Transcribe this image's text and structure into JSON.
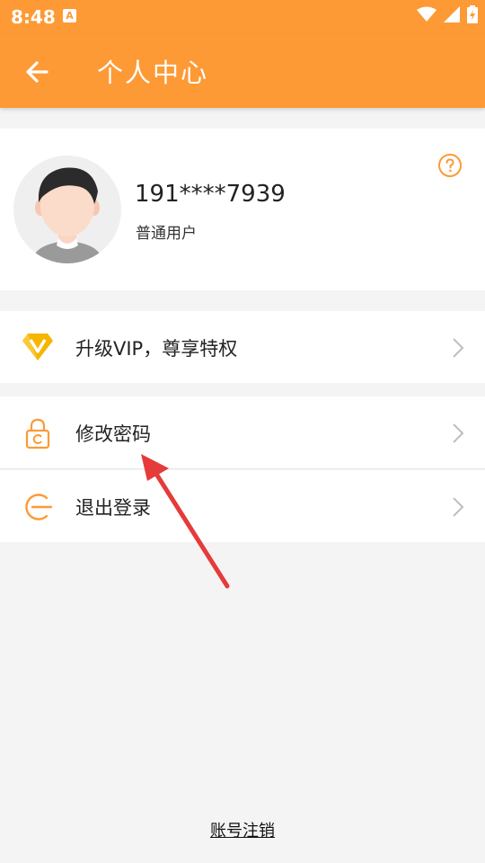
{
  "status_bar": {
    "time": "8:48",
    "notification_glyph": "A"
  },
  "app_bar": {
    "title": "个人中心"
  },
  "profile": {
    "phone": "191****7939",
    "user_type": "普通用户"
  },
  "menu": {
    "vip_label": "升级VIP，尊享特权",
    "change_password_label": "修改密码",
    "logout_label": "退出登录"
  },
  "footer": {
    "cancel_account_label": "账号注销"
  },
  "colors": {
    "accent": "#fd9a35",
    "background": "#f4f4f4",
    "annotation_arrow": "#e53b3b"
  }
}
